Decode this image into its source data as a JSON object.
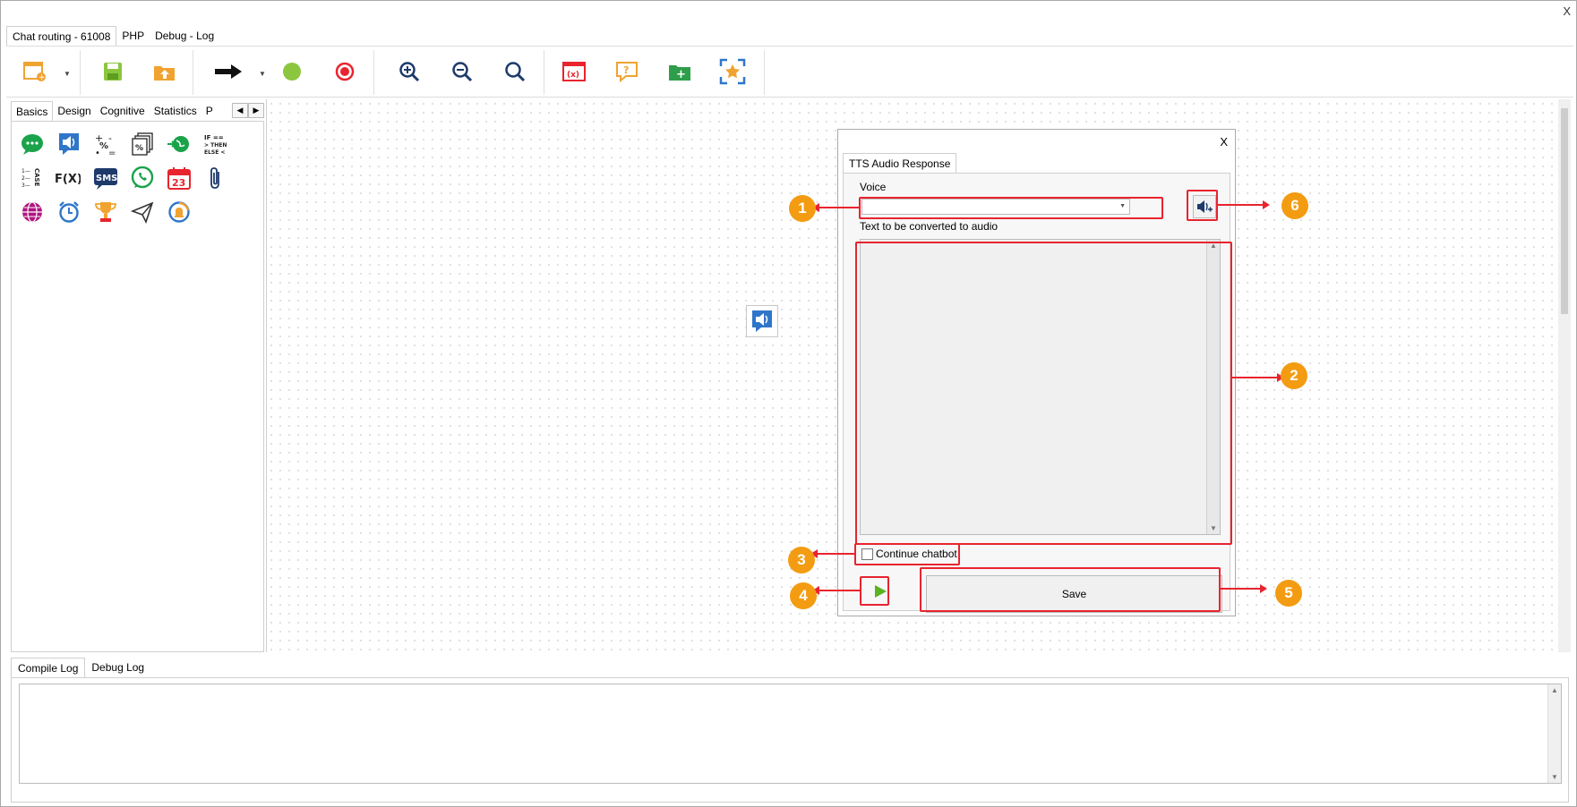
{
  "window": {
    "close": "X"
  },
  "top_tabs": [
    "Chat routing - 61008",
    "PHP",
    "Debug - Log"
  ],
  "toolbar": {
    "icons": [
      "new-flow-icon",
      "save-icon",
      "upload-icon",
      "arrow-right-icon",
      "green-dot-icon",
      "record-icon",
      "zoom-in-icon",
      "zoom-out-icon",
      "search-icon",
      "variables-icon",
      "help-icon",
      "add-folder-icon",
      "fit-screen-icon"
    ]
  },
  "palette": {
    "tabs": [
      "Basics",
      "Design",
      "Cognitive",
      "Statistics",
      "P"
    ],
    "icon_text": {
      "fx": "F(X)",
      "sms": "SMS",
      "calendar": "23"
    }
  },
  "dialog": {
    "close": "X",
    "tab": "TTS Audio Response",
    "voice_label": "Voice",
    "voice_value": "",
    "text_label": "Text to be converted to audio",
    "text_value": "",
    "continue_label": "Continue chatbot",
    "continue_checked": false,
    "save_label": "Save"
  },
  "annotations": [
    "1",
    "2",
    "3",
    "4",
    "5",
    "6"
  ],
  "log": {
    "tabs": [
      "Compile Log",
      "Debug Log"
    ]
  },
  "colors": {
    "highlight": "#e8242e",
    "badge": "#f39c12"
  }
}
